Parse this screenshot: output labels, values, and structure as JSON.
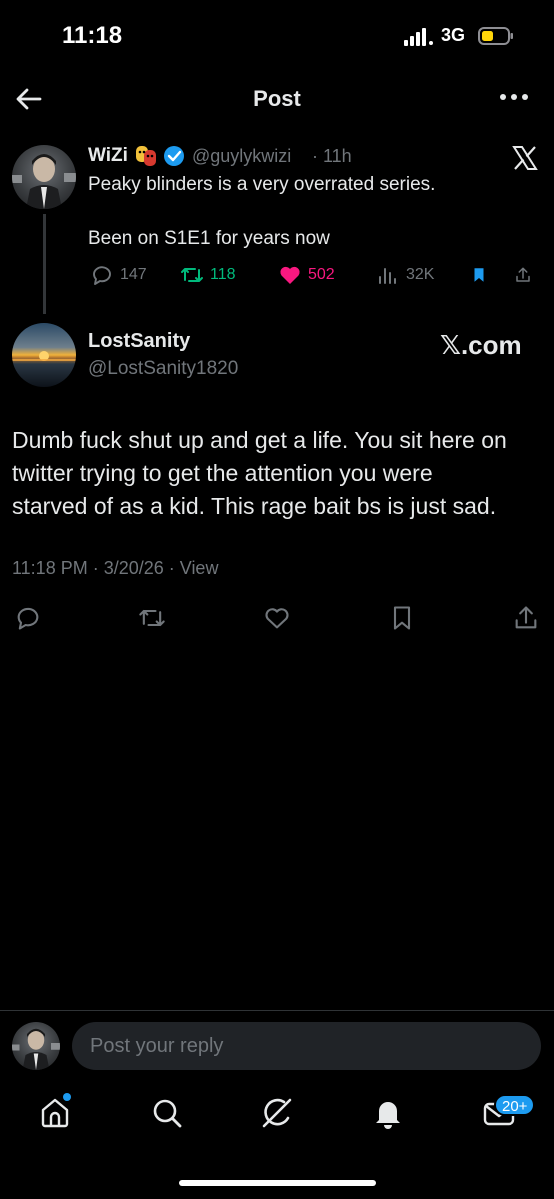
{
  "status_bar": {
    "time": "11:18",
    "network": "3G"
  },
  "header": {
    "title": "Post"
  },
  "quoted_post": {
    "name": "WiZi",
    "handle": "@guylykwizi",
    "time": "· 11h",
    "text_line1": "Peaky blinders is a very overrated series.",
    "text_line2": "Been on S1E1 for years now",
    "replies": "147",
    "reposts": "118",
    "likes": "502",
    "views": "32K"
  },
  "reply_post": {
    "name": "LostSanity",
    "handle": "@LostSanity1820",
    "watermark": "𝕏.com",
    "lines": [
      "Dumb fuck shut up and get a life. You sit here on",
      "twitter trying to get the attention you were",
      "starved of as a kid. This rage bait bs is just sad."
    ],
    "meta": "11:18 PM · 3/20/26 · View"
  },
  "reply_bar": {
    "placeholder": "Post your reply"
  },
  "tab_bar": {
    "messages_badge": "20+"
  },
  "colors": {
    "accent": "#1d9bf0",
    "like": "#f91880",
    "repost": "#00ba7c",
    "muted": "#71767b"
  }
}
